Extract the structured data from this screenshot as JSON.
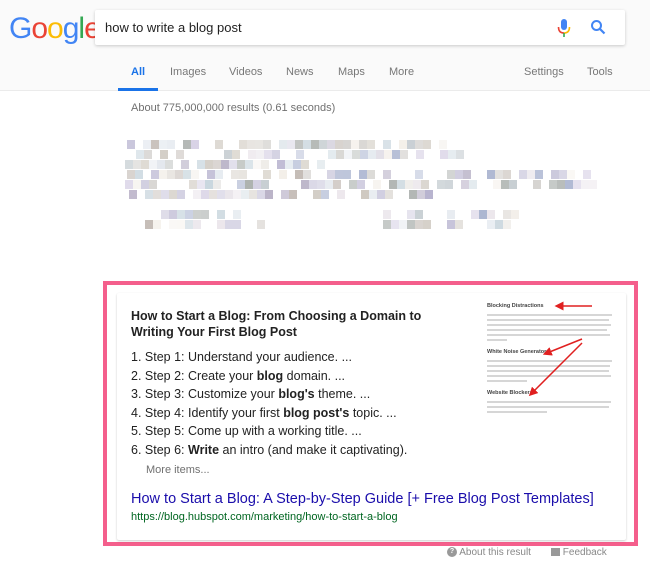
{
  "logo": {
    "text": "Google",
    "letters": [
      {
        "char": "G",
        "color": "#4285F4"
      },
      {
        "char": "o",
        "color": "#EA4335"
      },
      {
        "char": "o",
        "color": "#FBBC05"
      },
      {
        "char": "g",
        "color": "#4285F4"
      },
      {
        "char": "l",
        "color": "#34A853"
      },
      {
        "char": "e",
        "color": "#EA4335"
      }
    ]
  },
  "search": {
    "query": "how to write a blog post",
    "mic_icon": "microphone-icon",
    "search_icon": "magnifier-icon"
  },
  "tabs": [
    {
      "label": "All",
      "active": true
    },
    {
      "label": "Images",
      "active": false
    },
    {
      "label": "Videos",
      "active": false
    },
    {
      "label": "News",
      "active": false
    },
    {
      "label": "Maps",
      "active": false
    },
    {
      "label": "More",
      "active": false
    },
    {
      "label": "Settings",
      "active": false
    },
    {
      "label": "Tools",
      "active": false
    }
  ],
  "result_stats": "About 775,000,000 results (0.61 seconds)",
  "featured_snippet": {
    "title": "How to Start a Blog: From Choosing a Domain to Writing Your First Blog Post",
    "steps": [
      {
        "num": "1.",
        "pre": "Step 1: Understand your audience. ...",
        "bold": "",
        "post": ""
      },
      {
        "num": "2.",
        "pre": "Step 2: Create your ",
        "bold": "blog",
        "post": " domain. ..."
      },
      {
        "num": "3.",
        "pre": "Step 3: Customize your ",
        "bold": "blog's",
        "post": " theme. ..."
      },
      {
        "num": "4.",
        "pre": "Step 4: Identify your first ",
        "bold": "blog post's",
        "post": " topic. ..."
      },
      {
        "num": "5.",
        "pre": "Step 5: Come up with a working title. ...",
        "bold": "",
        "post": ""
      },
      {
        "num": "6.",
        "pre": "Step 6: ",
        "bold": "Write",
        "post": " an intro (and make it captivating)."
      }
    ],
    "more_items": "More items...",
    "link_text": "How to Start a Blog: A Step-by-Step Guide [+ Free Blog Post Templates]",
    "url": "https://blog.hubspot.com/marketing/how-to-start-a-blog",
    "thumbnail": {
      "headings": [
        "Blocking Distractions",
        "White Noise Generators",
        "Website Blockers"
      ]
    }
  },
  "footer": {
    "about": "About this result",
    "feedback": "Feedback"
  },
  "colors": {
    "highlight_border": "#f45f8c",
    "link": "#1a0dab",
    "url": "#006621",
    "active_tab": "#1a73e8"
  }
}
